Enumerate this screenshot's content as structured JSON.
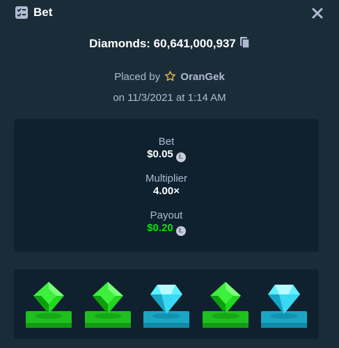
{
  "header": {
    "title": "Bet"
  },
  "game": {
    "name": "Diamonds: 60,641,000,937"
  },
  "placed": {
    "prefix": "Placed by",
    "user": "OranGek",
    "date": "on 11/3/2021 at 1:14 AM"
  },
  "stats": {
    "bet": {
      "label": "Bet",
      "value": "$0.05",
      "currency": "Ł"
    },
    "multiplier": {
      "label": "Multiplier",
      "value": "4.00×"
    },
    "payout": {
      "label": "Payout",
      "value": "$0.20",
      "currency": "Ł"
    }
  },
  "colors": {
    "background": "#1a2c38",
    "panel": "#0f212e",
    "payout": "#00e701",
    "label": "#b1bad3"
  },
  "gems": [
    {
      "type": "emerald",
      "color": "green"
    },
    {
      "type": "emerald",
      "color": "green"
    },
    {
      "type": "diamond",
      "color": "cyan"
    },
    {
      "type": "emerald",
      "color": "green"
    },
    {
      "type": "diamond",
      "color": "cyan"
    }
  ]
}
